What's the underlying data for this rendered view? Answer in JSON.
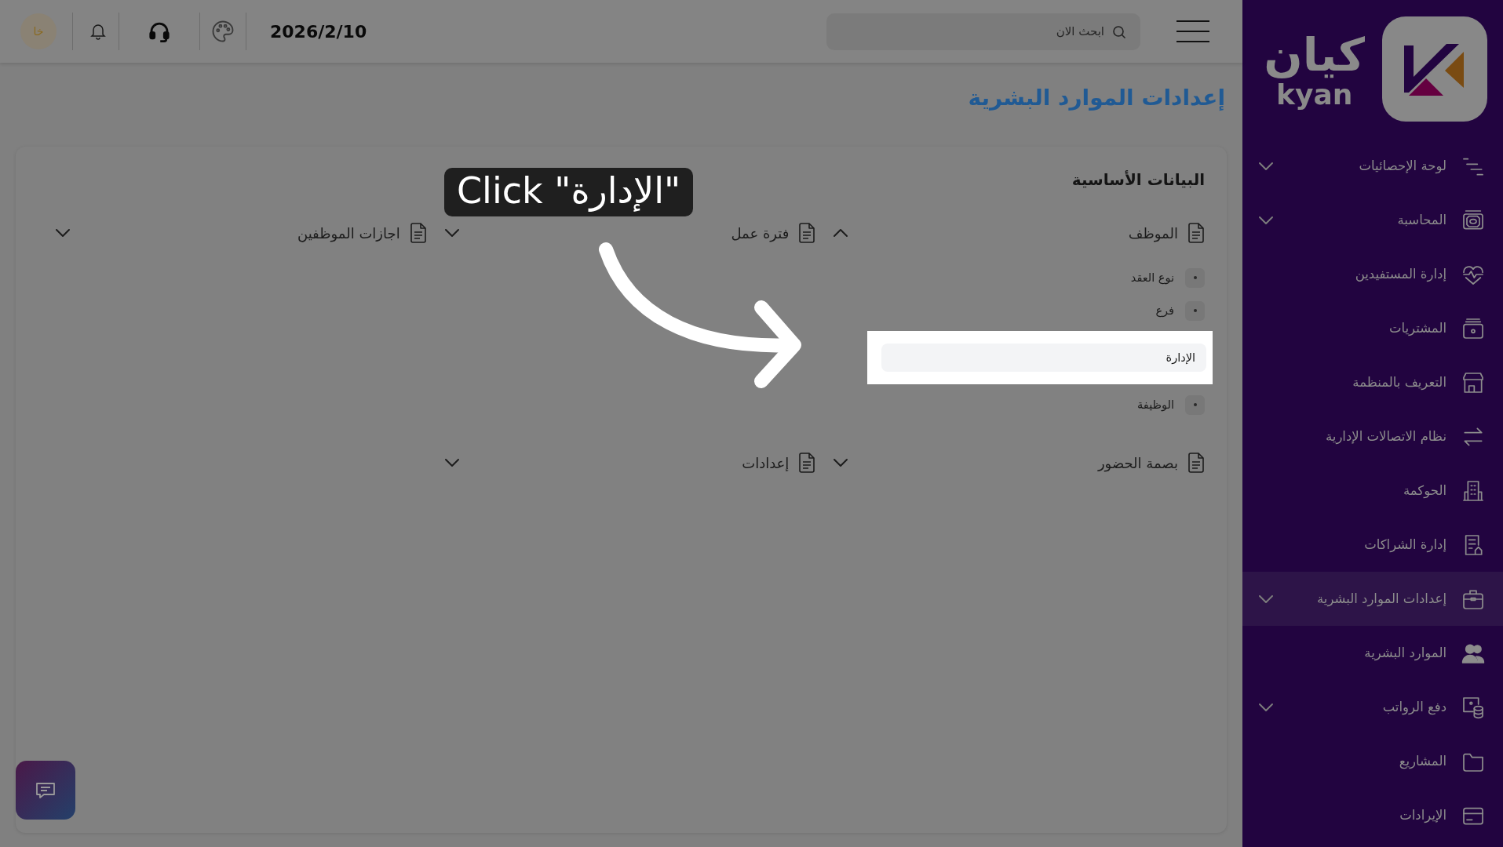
{
  "sidebar": {
    "logo": {
      "arabic": "كيان",
      "latin": "kyan"
    },
    "items": [
      {
        "label": "لوحة الإحصائيات",
        "expandable": true,
        "selected": false
      },
      {
        "label": "المحاسبة",
        "expandable": true,
        "selected": false
      },
      {
        "label": "إدارة المستفيدين",
        "expandable": false,
        "selected": false
      },
      {
        "label": "المشتريات",
        "expandable": false,
        "selected": false
      },
      {
        "label": "التعريف بالمنظمة",
        "expandable": false,
        "selected": false
      },
      {
        "label": "نظام الاتصالات الإدارية",
        "expandable": false,
        "selected": false
      },
      {
        "label": "الحوكمة",
        "expandable": false,
        "selected": false
      },
      {
        "label": "إدارة الشراكات",
        "expandable": false,
        "selected": false
      },
      {
        "label": "إعدادات الموارد البشرية",
        "expandable": true,
        "selected": true
      },
      {
        "label": "الموارد البشرية",
        "expandable": false,
        "selected": false
      },
      {
        "label": "دفع الرواتب",
        "expandable": true,
        "selected": false
      },
      {
        "label": "المشاريع",
        "expandable": false,
        "selected": false
      },
      {
        "label": "الإيرادات",
        "expandable": false,
        "selected": false
      }
    ]
  },
  "topbar": {
    "search": {
      "placeholder": "ابحث الان"
    },
    "date": "2026/2/10",
    "avatar": {
      "initials": "خا"
    }
  },
  "page_title": "إعدادات الموارد البشرية",
  "card": {
    "title": "البيانات الأساسية",
    "groups": [
      {
        "label": "الموظف",
        "expanded": true,
        "children": [
          {
            "label": "نوع العقد",
            "highlighted": false
          },
          {
            "label": "فرع",
            "highlighted": false
          },
          {
            "label": "الإدارة",
            "highlighted": true
          },
          {
            "label": "الوظيفة",
            "highlighted": false
          }
        ]
      },
      {
        "label": "فترة عمل",
        "expanded": false
      },
      {
        "label": "اجازات الموظفين",
        "expanded": false
      },
      {
        "label": "بصمة الحضور",
        "expanded": false
      },
      {
        "label": "إعدادات",
        "expanded": false
      }
    ]
  },
  "tutorial": {
    "callout": "Click \"الإدارة\""
  }
}
